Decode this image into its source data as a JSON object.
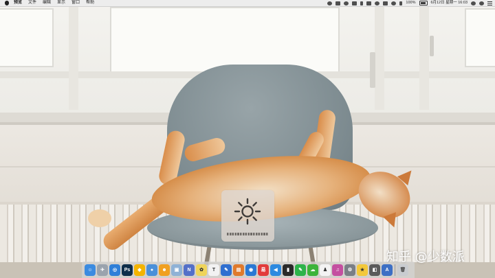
{
  "menubar": {
    "app_name": "预览",
    "items": [
      "文件",
      "编辑",
      "显示",
      "窗口",
      "帮助"
    ],
    "battery": "100%",
    "clock": "6月12日 星期一 16:03"
  },
  "hud": {
    "type": "brightness",
    "level": 0.85
  },
  "dock": {
    "apps": [
      {
        "name": "finder-icon",
        "color": "#3b8be0",
        "glyph": "☺"
      },
      {
        "name": "launchpad-icon",
        "color": "#9aa3ad",
        "glyph": "✈"
      },
      {
        "name": "safari-icon",
        "color": "#2f7fd8",
        "glyph": "◎"
      },
      {
        "name": "photoshop-icon",
        "color": "#0f2e4a",
        "glyph": "Ps"
      },
      {
        "name": "sketch-icon",
        "color": "#f4b400",
        "glyph": "◆"
      },
      {
        "name": "chrome-icon",
        "color": "#4a90d9",
        "glyph": "●"
      },
      {
        "name": "emoji-app-icon",
        "color": "#f0a020",
        "glyph": "☻"
      },
      {
        "name": "preview-icon",
        "color": "#8fb2d6",
        "glyph": "▣"
      },
      {
        "name": "n-app-icon",
        "color": "#5470c8",
        "glyph": "N"
      },
      {
        "name": "butterfly-app-icon",
        "color": "#efd45a",
        "glyph": "✿"
      },
      {
        "name": "typora-icon",
        "color": "#f2f2f2",
        "glyph": "T"
      },
      {
        "name": "pen-app-icon",
        "color": "#2f6fd0",
        "glyph": "✎"
      },
      {
        "name": "books-app-icon",
        "color": "#e07a2c",
        "glyph": "▤"
      },
      {
        "name": "finder-tool-icon",
        "color": "#2a78d4",
        "glyph": "◉"
      },
      {
        "name": "netease-icon",
        "color": "#e23b3b",
        "glyph": "易"
      },
      {
        "name": "vscode-icon",
        "color": "#2d8ae0",
        "glyph": "◀"
      },
      {
        "name": "terminal-icon",
        "color": "#2a2a2a",
        "glyph": "▮"
      },
      {
        "name": "evernote-icon",
        "color": "#2db34a",
        "glyph": "✎"
      },
      {
        "name": "wechat-icon",
        "color": "#3cb33a",
        "glyph": "☁"
      },
      {
        "name": "qq-icon",
        "color": "#f3f3f3",
        "glyph": "♟"
      },
      {
        "name": "music-app-icon",
        "color": "#c44fa0",
        "glyph": "♫"
      },
      {
        "name": "system-preferences-icon",
        "color": "#7a7f86",
        "glyph": "⚙"
      },
      {
        "name": "star-app-icon",
        "color": "#f3c83a",
        "glyph": "★"
      },
      {
        "name": "screenshot-app-icon",
        "color": "#5b5b5b",
        "glyph": "◧"
      },
      {
        "name": "app-store-icon",
        "color": "#3d6fc4",
        "glyph": "A"
      }
    ],
    "trash": {
      "name": "trash-icon",
      "color": "#c9ccd0",
      "glyph": "🗑"
    }
  },
  "watermark": "知乎 @少数派"
}
